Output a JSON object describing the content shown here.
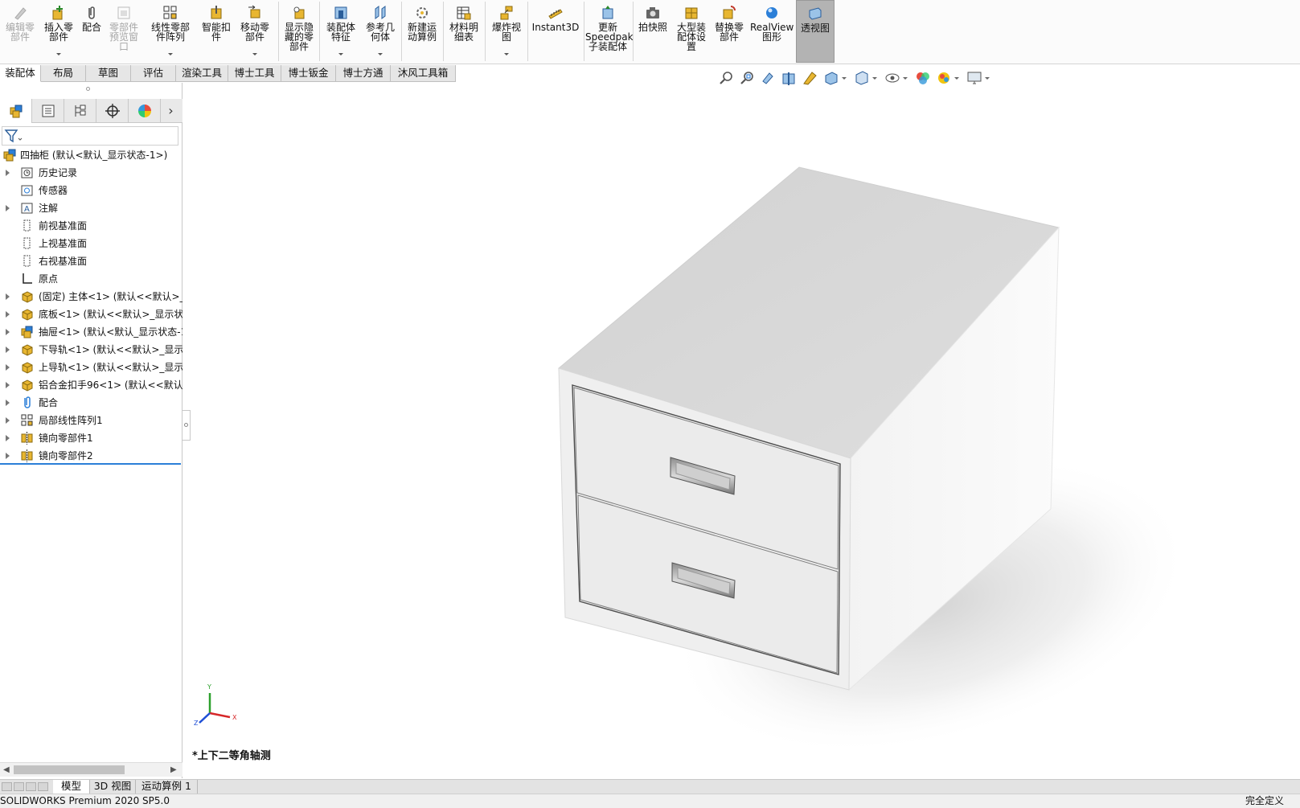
{
  "ribbon": {
    "edit_component": "编辑零\n部件",
    "insert_components": "插入零\n部件",
    "mate": "配合",
    "component_preview": "零部件\n预览窗\n口",
    "linear_pattern": "线性零部\n件阵列",
    "smart_fasteners": "智能扣\n件",
    "move_component": "移动零\n部件",
    "show_hidden": "显示隐\n藏的零\n部件",
    "assembly_features": "装配体\n特征",
    "reference_geometry": "参考几\n何体",
    "new_motion_study": "新建运\n动算例",
    "bill_of_materials": "材料明\n细表",
    "exploded_view": "爆炸视\n图",
    "instant3d": "Instant3D",
    "update_speedpak": "更新\nSpeedpak\n子装配体",
    "take_snapshot": "拍快照",
    "large_assembly": "大型装\n配体设\n置",
    "replace_components": "替换零\n部件",
    "realview": "RealView\n图形",
    "perspective": "透视图"
  },
  "command_tabs": [
    "装配体",
    "布局",
    "草图",
    "评估",
    "渲染工具",
    "博士工具",
    "博士钣金",
    "博士方通",
    "沐风工具箱"
  ],
  "tree": {
    "root": "四抽柜 (默认<默认_显示状态-1>)",
    "items": [
      {
        "label": "历史记录",
        "icon": "history-icon",
        "expand": true
      },
      {
        "label": "传感器",
        "icon": "sensor-icon",
        "expand": false
      },
      {
        "label": "注解",
        "icon": "annotation-icon",
        "expand": true
      },
      {
        "label": "前视基准面",
        "icon": "plane-icon",
        "expand": false
      },
      {
        "label": "上视基准面",
        "icon": "plane-icon",
        "expand": false
      },
      {
        "label": "右视基准面",
        "icon": "plane-icon",
        "expand": false
      },
      {
        "label": "原点",
        "icon": "origin-icon",
        "expand": false
      },
      {
        "label": "(固定) 主体<1> (默认<<默认>_显示状态",
        "icon": "part-icon",
        "expand": true
      },
      {
        "label": "底板<1> (默认<<默认>_显示状态",
        "icon": "part-icon",
        "expand": true
      },
      {
        "label": "抽屉<1> (默认<默认_显示状态-1",
        "icon": "subassembly-icon",
        "expand": true
      },
      {
        "label": "下导轨<1> (默认<<默认>_显示状",
        "icon": "part-icon",
        "expand": true
      },
      {
        "label": "上导轨<1> (默认<<默认>_显示状",
        "icon": "part-icon",
        "expand": true
      },
      {
        "label": "铝合金扣手96<1> (默认<<默认>",
        "icon": "part-icon",
        "expand": true
      },
      {
        "label": "配合",
        "icon": "mate-icon",
        "expand": true
      },
      {
        "label": "局部线性阵列1",
        "icon": "pattern-icon",
        "expand": true
      },
      {
        "label": "镜向零部件1",
        "icon": "mirror-icon",
        "expand": true
      },
      {
        "label": "镜向零部件2",
        "icon": "mirror-icon",
        "expand": true
      }
    ]
  },
  "viewport": {
    "view_name": "*上下二等角轴测",
    "triad": {
      "x": "X",
      "y": "Y",
      "z": "Z"
    }
  },
  "bottom_tabs": [
    "模型",
    "3D 视图",
    "运动算例 1"
  ],
  "status": {
    "left": "SOLIDWORKS Premium 2020 SP5.0",
    "right": "完全定义"
  },
  "colors": {
    "accent_blue": "#2b7fd8",
    "part_yellow": "#e8b631",
    "active_tool_bg": "#b3b3b3"
  }
}
